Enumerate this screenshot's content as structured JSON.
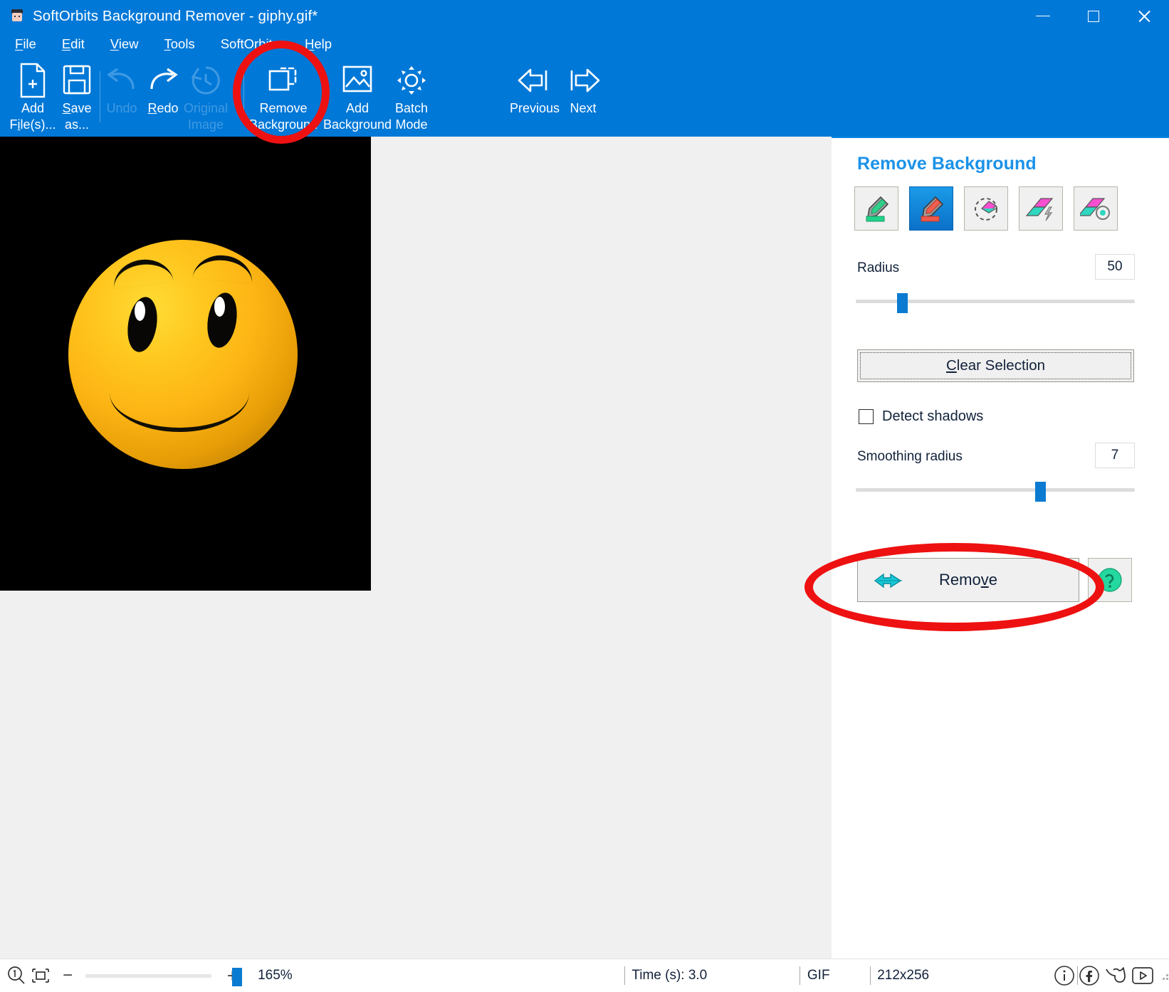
{
  "window": {
    "title": "SoftOrbits Background Remover - giphy.gif*",
    "app_icon": "app-icon",
    "controls": {
      "minimize": "minimize",
      "maximize": "maximize",
      "close": "close"
    }
  },
  "menubar": {
    "items": [
      {
        "label": "File",
        "accel": "F"
      },
      {
        "label": "Edit",
        "accel": "E"
      },
      {
        "label": "View",
        "accel": "V"
      },
      {
        "label": "Tools",
        "accel": "T"
      },
      {
        "label": "SoftOrbits",
        "accel": ""
      },
      {
        "label": "Help",
        "accel": "H"
      }
    ]
  },
  "toolbar": {
    "items": [
      {
        "line1": "Add",
        "line2": "File(s)...",
        "icon": "add-file-icon",
        "disabled": false
      },
      {
        "line1": "Save",
        "line2": "as...",
        "icon": "save-as-icon",
        "disabled": false
      },
      {
        "line1": "Undo",
        "line2": "",
        "icon": "undo-icon",
        "disabled": true
      },
      {
        "line1": "Redo",
        "line2": "",
        "icon": "redo-icon",
        "disabled": false
      },
      {
        "line1": "Original",
        "line2": "Image",
        "icon": "original-image-icon",
        "disabled": true
      },
      {
        "line1": "Remove",
        "line2": "Background",
        "icon": "remove-background-icon",
        "disabled": false
      },
      {
        "line1": "Add",
        "line2": "Background",
        "icon": "add-background-icon",
        "disabled": false
      },
      {
        "line1": "Batch",
        "line2": "Mode",
        "icon": "batch-mode-icon",
        "disabled": false
      },
      {
        "line1": "Previous",
        "line2": "",
        "icon": "previous-icon",
        "disabled": false
      },
      {
        "line1": "Next",
        "line2": "",
        "icon": "next-icon",
        "disabled": false
      }
    ]
  },
  "panel": {
    "title": "Remove Background",
    "tools": [
      {
        "name": "keep-marker-tool",
        "selected": false
      },
      {
        "name": "remove-marker-tool",
        "selected": true
      },
      {
        "name": "eraser-tool",
        "selected": false
      },
      {
        "name": "magic-wand-tool",
        "selected": false
      },
      {
        "name": "auto-select-tool",
        "selected": false
      }
    ],
    "radius": {
      "label": "Radius",
      "value": "50",
      "percent": 17
    },
    "clear_selection": {
      "label": "Clear Selection",
      "accel": "C"
    },
    "detect_shadows": {
      "label": "Detect shadows",
      "checked": false
    },
    "smoothing_radius": {
      "label": "Smoothing radius",
      "value": "7",
      "percent": 65
    },
    "remove": {
      "label": "Remove",
      "accel": "v",
      "icon": "right-arrow-icon"
    },
    "help_button": {
      "name": "help-icon"
    }
  },
  "statusbar": {
    "zoom_100_icon": "zoom-100-icon",
    "fit_icon": "fit-to-window-icon",
    "minus": "−",
    "plus": "+",
    "zoom_level": "165%",
    "time": "Time (s): 3.0",
    "format": "GIF",
    "dimensions": "212x256",
    "social": [
      {
        "name": "info-icon"
      },
      {
        "name": "facebook-icon"
      },
      {
        "name": "twitter-icon"
      },
      {
        "name": "youtube-icon"
      }
    ]
  },
  "canvas": {
    "image_name": "smiley-face-image",
    "background_color": "#000000"
  },
  "annotations": [
    {
      "name": "annotation-circle-remove-background-toolbar",
      "color": "#ee1111"
    },
    {
      "name": "annotation-circle-remove-button",
      "color": "#ee1111"
    }
  ],
  "colors": {
    "titlebar": "#0078d7",
    "panel_title": "#1b92e8",
    "accent": "#0a7bd1"
  }
}
